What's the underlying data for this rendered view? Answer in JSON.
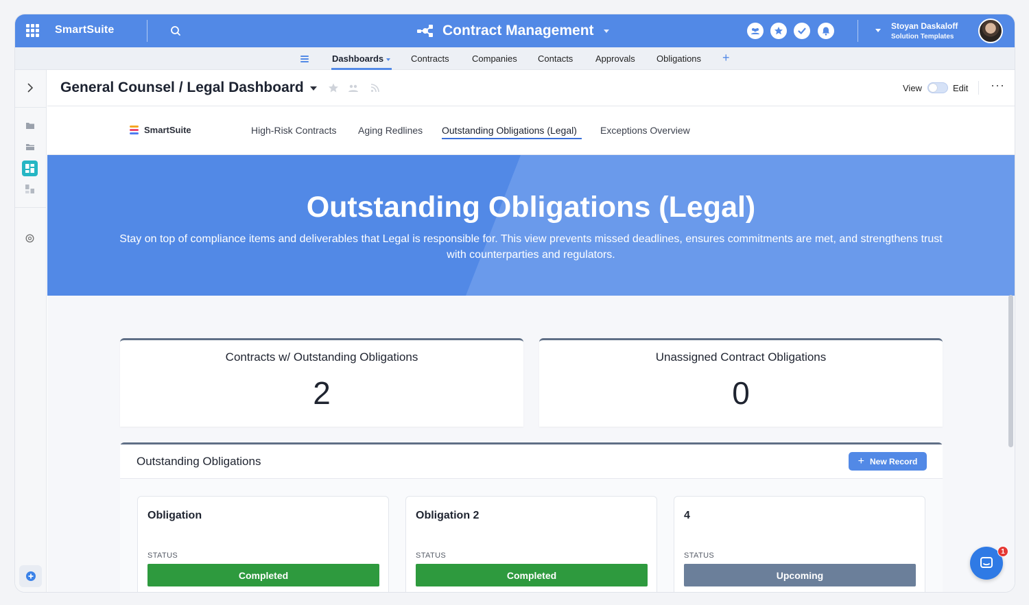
{
  "topbar": {
    "brand": "SmartSuite",
    "app_title": "Contract Management",
    "user_name": "Stoyan Daskaloff",
    "user_subtitle": "Solution Templates"
  },
  "nav": {
    "items": [
      {
        "label": "Dashboards",
        "active": true
      },
      {
        "label": "Contracts"
      },
      {
        "label": "Companies"
      },
      {
        "label": "Contacts"
      },
      {
        "label": "Approvals"
      },
      {
        "label": "Obligations"
      }
    ],
    "add_label": "+"
  },
  "header": {
    "title": "General Counsel / Legal Dashboard",
    "view_label": "View",
    "edit_label": "Edit",
    "more_label": "···"
  },
  "subnav": {
    "logo_text": "SmartSuite",
    "tabs": [
      {
        "label": "High-Risk Contracts"
      },
      {
        "label": "Aging Redlines"
      },
      {
        "label": "Outstanding Obligations (Legal)",
        "active": true
      },
      {
        "label": "Exceptions Overview"
      }
    ]
  },
  "hero": {
    "title": "Outstanding Obligations (Legal)",
    "description": "Stay on top of compliance items and deliverables that Legal is responsible for. This view prevents missed deadlines, ensures commitments are met, and strengthens trust with counterparties and regulators."
  },
  "kpis": [
    {
      "label": "Contracts w/ Outstanding Obligations",
      "value": "2"
    },
    {
      "label": "Unassigned Contract Obligations",
      "value": "0"
    }
  ],
  "obligations": {
    "title": "Outstanding Obligations",
    "new_record_label": "New Record",
    "status_label": "STATUS",
    "cards": [
      {
        "title": "Obligation",
        "status": "Completed",
        "status_color": "#2e9a3e"
      },
      {
        "title": "Obligation 2",
        "status": "Completed",
        "status_color": "#2e9a3e"
      },
      {
        "title": "4",
        "status": "Upcoming",
        "status_color": "#6b7f9a"
      }
    ]
  },
  "chat": {
    "badge": "1"
  },
  "colors": {
    "brand_blue": "#5289e6",
    "completed_green": "#2e9a3e",
    "upcoming_slate": "#6b7f9a"
  }
}
